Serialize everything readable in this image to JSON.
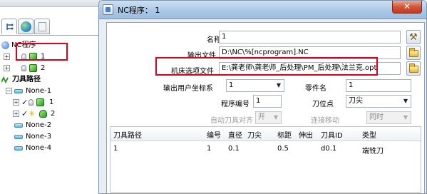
{
  "tree": {
    "nc_program_group": "NC程序",
    "programs": [
      {
        "label": "1"
      },
      {
        "label": "2"
      }
    ],
    "toolpath_group": "刀具路径",
    "toolpaths": [
      {
        "label": "None-1",
        "children": [
          {
            "label": "1"
          },
          {
            "label": "2"
          }
        ]
      },
      {
        "label": "None-2"
      },
      {
        "label": "None-3"
      },
      {
        "label": "None-4"
      }
    ],
    "expand_symbol": "+",
    "collapse_symbol": "−"
  },
  "dialog": {
    "title": "NC程序： 1",
    "close_symbol": "✕",
    "name_label": "名称",
    "name_value": "1",
    "output_file_label": "输出文件",
    "output_file_value": "D:\\NC\\%[ncprogram].NC",
    "machine_option_label": "机床选项文件",
    "machine_option_value": "E:\\龚老师\\龚老师_后处理\\PM_后处理\\法兰克.opt",
    "output_ucs_label": "输出用户坐标系",
    "output_ucs_value": "1",
    "part_label": "零件名",
    "part_value": "1",
    "program_number_label": "程序编号",
    "program_number_value": "1",
    "tool_position_label": "刀位点",
    "tool_position_value": "刀尖",
    "auto_tool_align_label": "自动刀具对齐",
    "auto_tool_align_value": "开",
    "link_move_label": "连接移动",
    "link_move_value": "同时",
    "table": {
      "columns": [
        "刀具路径",
        "编号",
        "直径",
        "刀尖",
        "标距",
        "伸出",
        "刀具ID",
        "类型"
      ],
      "rows": [
        [
          "1",
          "1",
          "0.1",
          "",
          "0.5",
          "",
          "d0.1",
          "端铣刀"
        ]
      ]
    }
  },
  "colors": {
    "highlight_red": "#e0001a",
    "titlebar": "#a9c6e4",
    "close_button": "#c23a1f"
  }
}
